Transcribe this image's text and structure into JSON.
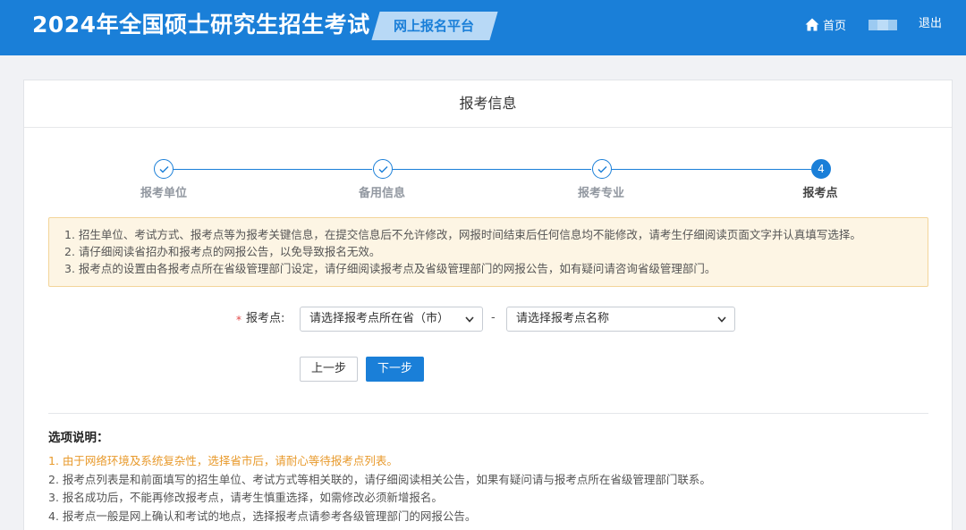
{
  "header": {
    "site_title": "2024年全国硕士研究生招生考试",
    "platform_label": "网上报名平台",
    "home_label": "首页",
    "logout_label": "退出",
    "brand_color": "#1a7fd8"
  },
  "page": {
    "title": "报考信息"
  },
  "steps": [
    {
      "label": "报考单位",
      "status": "done",
      "icon": "check-icon"
    },
    {
      "label": "备用信息",
      "status": "done",
      "icon": "check-icon"
    },
    {
      "label": "报考专业",
      "status": "done",
      "icon": "check-icon"
    },
    {
      "label": "报考点",
      "status": "active",
      "number": "4"
    }
  ],
  "notice": {
    "lines": [
      "1. 招生单位、考试方式、报考点等为报考关键信息，在提交信息后不允许修改，网报时间结束后任何信息均不能修改，请考生仔细阅读页面文字并认真填写选择。",
      "2. 请仔细阅读省招办和报考点的网报公告，以免导致报名无效。",
      "3. 报考点的设置由各报考点所在省级管理部门设定，请仔细阅读报考点及省级管理部门的网报公告，如有疑问请咨询省级管理部门。"
    ]
  },
  "form": {
    "required_mark": "*",
    "site_label": "报考点:",
    "province_select": "请选择报考点所在省（市）",
    "separator": "-",
    "site_select": "请选择报考点名称"
  },
  "buttons": {
    "prev": "上一步",
    "next": "下一步"
  },
  "explanation": {
    "title": "选项说明：",
    "lines": [
      "1. 由于网络环境及系统复杂性，选择省市后，请耐心等待报考点列表。",
      "2. 报考点列表是和前面填写的招生单位、考试方式等相关联的，请仔细阅读相关公告，如果有疑问请与报考点所在省级管理部门联系。",
      "3. 报名成功后，不能再修改报考点，请考生慎重选择，如需修改必须新增报名。",
      "4. 报考点一般是网上确认和考试的地点，选择报考点请参考各级管理部门的网报公告。"
    ]
  }
}
